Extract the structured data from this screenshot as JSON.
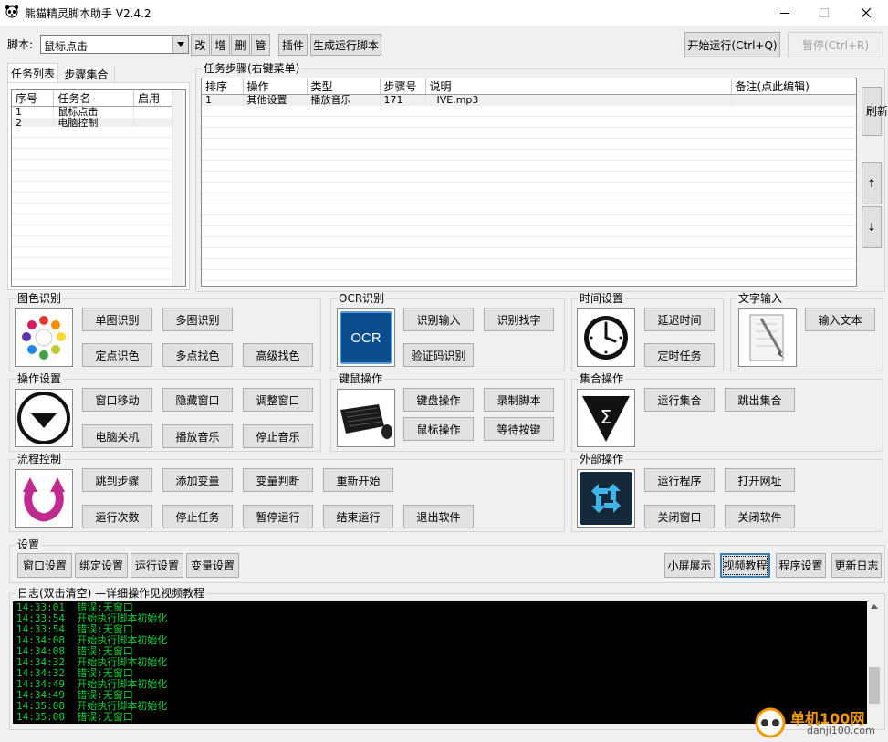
{
  "window": {
    "title": "熊猫精灵脚本助手  V2.4.2"
  },
  "toolbar": {
    "script_label": "脚本:",
    "script_value": "鼠标点击",
    "edit": "改",
    "add": "增",
    "del": "删",
    "manage": "管",
    "plugin": "插件",
    "gen": "生成运行脚本",
    "start": "开始运行(Ctrl+Q)",
    "pause": "暂停(Ctrl+R)"
  },
  "tabs": {
    "task_list": "任务列表",
    "step_set": "步骤集合"
  },
  "task_table": {
    "headers": [
      "序号",
      "任务名",
      "启用"
    ],
    "rows": [
      [
        "1",
        "鼠标点击",
        ""
      ],
      [
        "2",
        "电脑控制",
        ""
      ]
    ]
  },
  "steps": {
    "title": "任务步骤(右键菜单)",
    "headers": [
      "排序",
      "操作",
      "类型",
      "步骤号",
      "说明",
      "备注(点此编辑)"
    ],
    "rows": [
      [
        "1",
        "其他设置",
        "播放音乐",
        "171",
        "IVE.mp3",
        ""
      ]
    ],
    "refresh": "刷新",
    "up": "↑",
    "down": "↓"
  },
  "image_recog": {
    "title": "图色识别",
    "b1": "单图识别",
    "b2": "多图识别",
    "b3": "定点识色",
    "b4": "多点找色",
    "b5": "高级找色"
  },
  "ocr": {
    "title": "OCR识别",
    "icon_text": "OCR",
    "b1": "识别输入",
    "b2": "识别找字",
    "b3": "验证码识别"
  },
  "time": {
    "title": "时间设置",
    "b1": "延迟时间",
    "b2": "定时任务"
  },
  "text_input": {
    "title": "文字输入",
    "b1": "输入文本"
  },
  "ops": {
    "title": "操作设置",
    "b1": "窗口移动",
    "b2": "隐藏窗口",
    "b3": "调整窗口",
    "b4": "电脑关机",
    "b5": "播放音乐",
    "b6": "停止音乐"
  },
  "kbm": {
    "title": "键鼠操作",
    "b1": "键盘操作",
    "b2": "录制脚本",
    "b3": "鼠标操作",
    "b4": "等待按键"
  },
  "collection": {
    "title": "集合操作",
    "b1": "运行集合",
    "b2": "跳出集合"
  },
  "flow": {
    "title": "流程控制",
    "b1": "跳到步骤",
    "b2": "添加变量",
    "b3": "变量判断",
    "b4": "重新开始",
    "b5": "运行次数",
    "b6": "停止任务",
    "b7": "暂停运行",
    "b8": "结束运行",
    "b9": "退出软件"
  },
  "external": {
    "title": "外部操作",
    "b1": "运行程序",
    "b2": "打开网址",
    "b3": "关闭窗口",
    "b4": "关闭软件"
  },
  "settings": {
    "title": "设置",
    "b1": "窗口设置",
    "b2": "绑定设置",
    "b3": "运行设置",
    "b4": "变量设置",
    "b5": "小屏展示",
    "b6": "视频教程",
    "b7": "程序设置",
    "b8": "更新日志"
  },
  "log": {
    "title": "日志(双击清空)   —详细操作见视频教程",
    "lines": [
      "14:33:01  错误:无窗口",
      "14:33:54  开始执行脚本初始化",
      "14:33:54  错误:无窗口",
      "14:34:08  开始执行脚本初始化",
      "14:34:08  错误:无窗口",
      "14:34:32  开始执行脚本初始化",
      "14:34:32  错误:无窗口",
      "14:34:49  开始执行脚本初始化",
      "14:34:49  错误:无窗口",
      "14:35:08  开始执行脚本初始化",
      "14:35:08  错误:无窗口"
    ]
  },
  "watermark": {
    "name": "单机100网",
    "url": "danji100.com"
  }
}
